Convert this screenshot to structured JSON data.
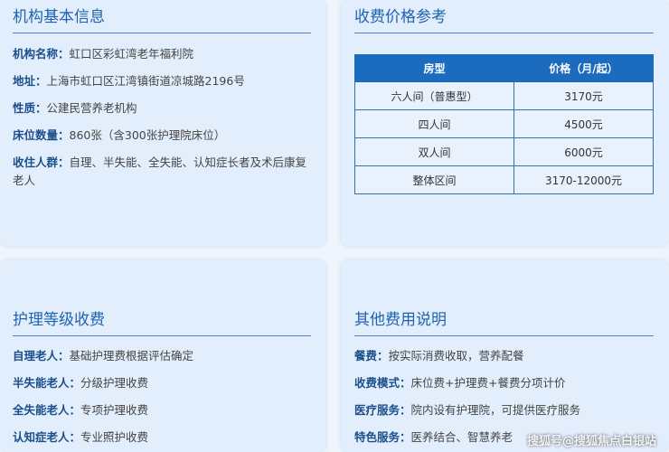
{
  "basic": {
    "title": "机构基本信息",
    "rows": [
      {
        "label": "机构名称：",
        "value": "虹口区彩虹湾老年福利院"
      },
      {
        "label": "地址：",
        "value": "上海市虹口区江湾镇街道凉城路2196号"
      },
      {
        "label": "性质：",
        "value": "公建民营养老机构"
      },
      {
        "label": "床位数量：",
        "value": "860张（含300张护理院床位）"
      },
      {
        "label": "收住人群：",
        "value": "自理、半失能、全失能、认知症长者及术后康复老人"
      }
    ]
  },
  "price": {
    "title": "收费价格参考",
    "headers": [
      "房型",
      "价格（月/起）"
    ],
    "rows": [
      [
        "六人间（普惠型）",
        "3170元"
      ],
      [
        "四人间",
        "4500元"
      ],
      [
        "双人间",
        "6000元"
      ],
      [
        "整体区间",
        "3170-12000元"
      ]
    ]
  },
  "care": {
    "title": "护理等级收费",
    "rows": [
      {
        "label": "自理老人：",
        "value": "基础护理费根据评估确定"
      },
      {
        "label": "半失能老人：",
        "value": "分级护理收费"
      },
      {
        "label": "全失能老人：",
        "value": "专项护理收费"
      },
      {
        "label": "认知症老人：",
        "value": "专业照护收费"
      }
    ]
  },
  "other": {
    "title": "其他费用说明",
    "rows": [
      {
        "label": "餐费：",
        "value": "按实际消费收取，营养配餐"
      },
      {
        "label": "收费模式：",
        "value": "床位费+护理费+餐费分项计价"
      },
      {
        "label": "医疗服务：",
        "value": "院内设有护理院，可提供医疗服务"
      },
      {
        "label": "特色服务：",
        "value": "医养结合、智慧养老"
      }
    ]
  },
  "watermark": "搜狐号@搜狐焦点白银站"
}
